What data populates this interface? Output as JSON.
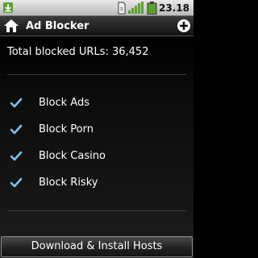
{
  "status_bar": {
    "time": "23.18",
    "icons": [
      "download-notification-icon",
      "sim-card-icon",
      "signal-icon",
      "battery-icon"
    ]
  },
  "title_bar": {
    "title": "Ad Blocker",
    "home_icon": "home-icon",
    "add_icon": "add-icon"
  },
  "main": {
    "total_label": "Total blocked URLs: 36,452",
    "options": [
      {
        "label": "Block Ads",
        "checked": true
      },
      {
        "label": "Block Porn",
        "checked": true
      },
      {
        "label": "Block Casino",
        "checked": true
      },
      {
        "label": "Block Risky",
        "checked": true
      }
    ]
  },
  "footer": {
    "install_label": "Download & Install Hosts"
  },
  "colors": {
    "check_accent": "#7ec5f0",
    "background": "#000000"
  }
}
